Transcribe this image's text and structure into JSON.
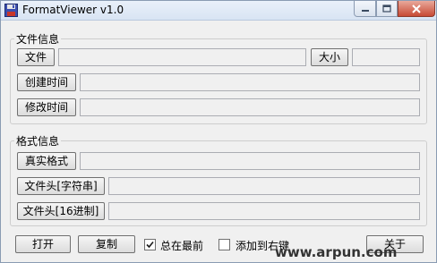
{
  "window": {
    "title": "FormatViewer v1.0"
  },
  "file_info": {
    "legend": "文件信息",
    "file_label": "文件",
    "file_value": "",
    "size_label": "大小",
    "size_value": "",
    "created_label": "创建时间",
    "created_value": "",
    "modified_label": "修改时间",
    "modified_value": ""
  },
  "format_info": {
    "legend": "格式信息",
    "real_format_label": "真实格式",
    "real_format_value": "",
    "header_string_label": "文件头[字符串]",
    "header_string_value": "",
    "header_hex_label": "文件头[16进制]",
    "header_hex_value": ""
  },
  "footer": {
    "open_label": "打开",
    "copy_label": "复制",
    "always_on_top_label": "总在最前",
    "always_on_top_checked": true,
    "add_context_menu_label": "添加到右键",
    "add_context_menu_checked": false,
    "close_label": "关于"
  },
  "watermark": "www.arpun.com"
}
